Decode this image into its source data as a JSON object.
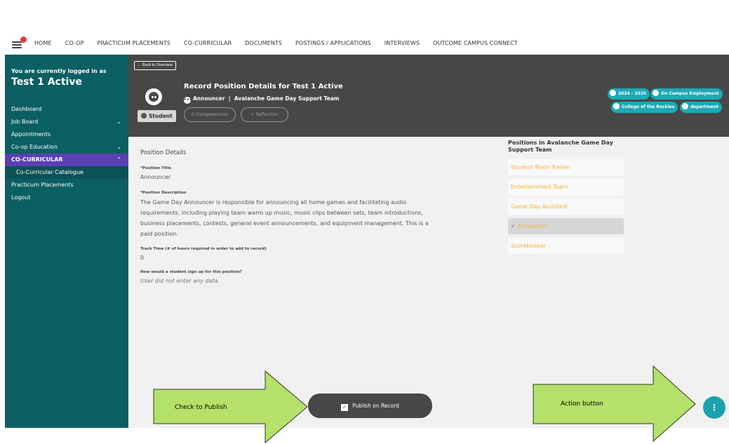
{
  "nav": {
    "items": [
      "HOME",
      "CO-OP",
      "PRACTICUM PLACEMENTS",
      "CO-CURRICULAR",
      "DOCUMENTS",
      "POSTINGS / APPLICATIONS",
      "INTERVIEWS",
      "OUTCOME CAMPUS CONNECT"
    ]
  },
  "sidebar": {
    "logged_in_label": "You are currently logged in as",
    "user_name": "Test 1 Active",
    "items": [
      {
        "label": "Dashboard"
      },
      {
        "label": "Job Board"
      },
      {
        "label": "Appointments"
      },
      {
        "label": "Co-op Education"
      },
      {
        "label": "CO-CURRICULAR"
      },
      {
        "label": "Co-Curricular Catalogue"
      },
      {
        "label": "Practicum Placements"
      },
      {
        "label": "Logout"
      }
    ]
  },
  "header": {
    "back_label": "← Back to Overview",
    "title": "Record Position Details for Test 1 Active",
    "position": "Announcer",
    "separator": "|",
    "team": "Avalanche Game Day Support Team",
    "student_badge": "Student",
    "competencies_label": "0 Competencies",
    "reflection_label": "+ Reflection",
    "tags": [
      "2024 - 2025",
      "On Campus Employment",
      "College of the Rockies",
      "department"
    ]
  },
  "details": {
    "section_title": "Position Details",
    "title_label": "*Position Title",
    "title_value": "Announcer",
    "description_label": "*Position Description",
    "description_value": "The Game Day Announcer is responsible for announcing all home games and facilitating audio requirements, including playing team warm up music, music clips between sets, team introductions, business placements, contests, general event announcements, and equipment management. This is a paid position.",
    "track_label": "Track Time (# of hours required in order to add to record)",
    "track_value": "0",
    "signup_label": "How would a student sign up for this position?",
    "signup_value": "User did not enter any data."
  },
  "positions": {
    "heading": "Positions in Avalanche Game Day Support Team",
    "items": [
      {
        "label": "Student Team Trainer"
      },
      {
        "label": "Entertainment Team"
      },
      {
        "label": "Game Day Assistant"
      },
      {
        "label": "Announcer"
      },
      {
        "label": "Scorekeeper"
      }
    ]
  },
  "actions": {
    "publish_label": "Publish on Record",
    "action_icon": "⋮"
  },
  "annotations": {
    "publish_hint": "Check to Publish",
    "action_hint": "Action button"
  },
  "colors": {
    "sidebar": "#0a5f63",
    "active_nav": "#5a40b5",
    "header": "#474747",
    "accent": "#1da9b5",
    "position_link": "#f5b13c",
    "arrow": "#b5e06a"
  }
}
